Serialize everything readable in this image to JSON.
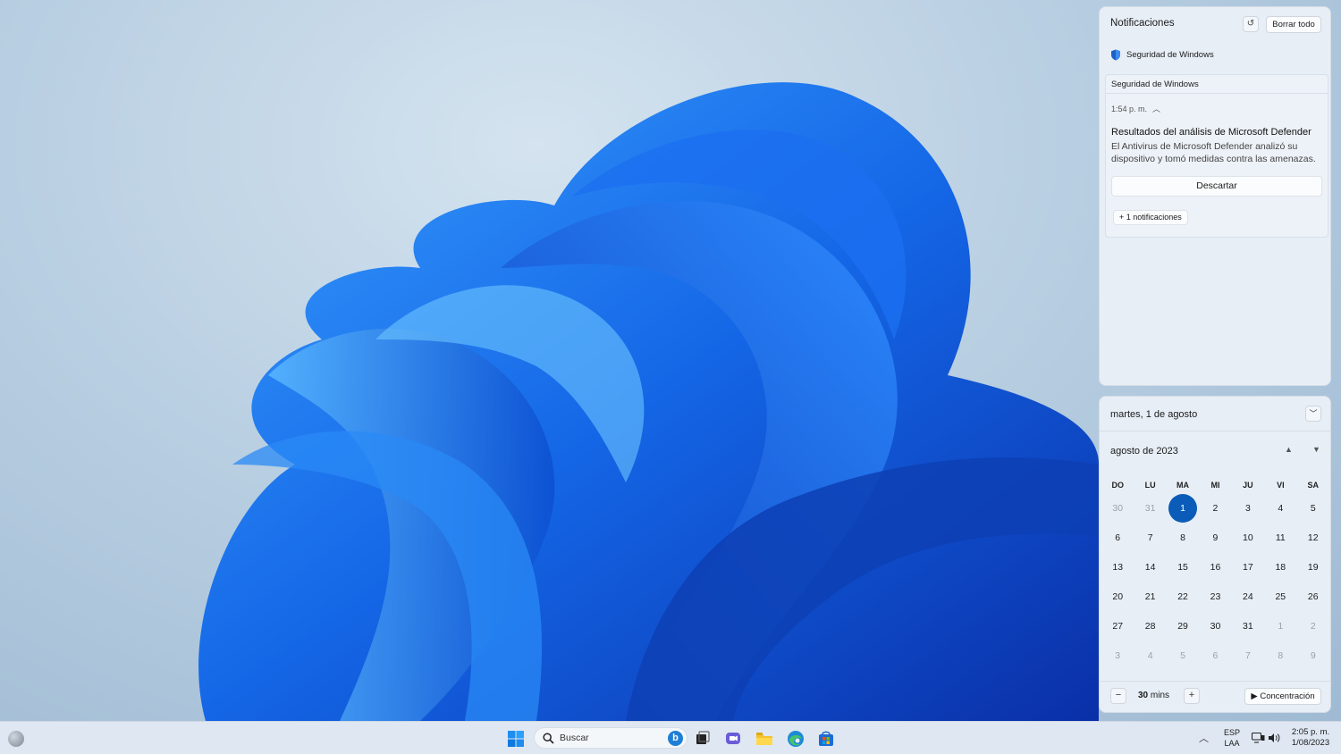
{
  "notifications": {
    "header": "Notificaciones",
    "dnd_icon": "snooze-icon",
    "clear_all": "Borrar todo",
    "app_name": "Seguridad de Windows",
    "group": {
      "title": "Seguridad de Windows",
      "time": "1:54 p. m.",
      "notif_title": "Resultados del análisis de Microsoft Defender",
      "notif_body": "El Antivirus de Microsoft Defender analizó su dispositivo y tomó medidas contra las amenazas.",
      "dismiss": "Descartar",
      "more": "+ 1 notificaciones"
    }
  },
  "calendar": {
    "date_label": "martes, 1 de agosto",
    "month_label": "agosto de 2023",
    "weekdays": [
      "DO",
      "LU",
      "MA",
      "MI",
      "JU",
      "VI",
      "SA"
    ],
    "weeks": [
      [
        "30",
        "31",
        "1",
        "2",
        "3",
        "4",
        "5"
      ],
      [
        "6",
        "7",
        "8",
        "9",
        "10",
        "11",
        "12"
      ],
      [
        "13",
        "14",
        "15",
        "16",
        "17",
        "18",
        "19"
      ],
      [
        "20",
        "21",
        "22",
        "23",
        "24",
        "25",
        "26"
      ],
      [
        "27",
        "28",
        "29",
        "30",
        "31",
        "1",
        "2"
      ],
      [
        "3",
        "4",
        "5",
        "6",
        "7",
        "8",
        "9"
      ]
    ],
    "focus": {
      "minus": "−",
      "value": "30",
      "unit": "mins",
      "plus": "+",
      "button": "Concentración"
    }
  },
  "taskbar": {
    "search_placeholder": "Buscar",
    "language_line1": "ESP",
    "language_line2": "LAA",
    "time": "2:05 p. m.",
    "date": "1/08/2023"
  },
  "colors": {
    "accent": "#0a5cb8",
    "panel_bg": "#e7eef6"
  }
}
